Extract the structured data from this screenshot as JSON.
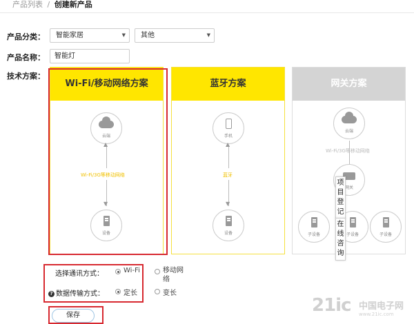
{
  "breadcrumb": {
    "parent": "产品列表",
    "separator": "/",
    "current": "创建新产品"
  },
  "form": {
    "category_label": "产品分类：",
    "category_primary": "智能家居",
    "category_secondary": "其他",
    "name_label": "产品名称：",
    "name_value": "智能灯",
    "solution_label": "技术方案："
  },
  "cards": {
    "wifi": {
      "title": "Wi-Fi/移动网络方案",
      "cloud_label": "云端",
      "link_text": "Wi-Fi/3G等移动网络",
      "device_label": "设备"
    },
    "bluetooth": {
      "title": "蓝牙方案",
      "phone_label": "手机",
      "link_text": "蓝牙",
      "device_label": "设备"
    },
    "gateway": {
      "title": "网关方案",
      "cloud_label": "云端",
      "link_text": "Wi-Fi/3G等移动网络",
      "gateway_label": "网关",
      "sub_device_label": "子设备"
    }
  },
  "options": {
    "comm_label": "选择通讯方式：",
    "comm_options": [
      "Wi-Fi",
      "移动网络"
    ],
    "comm_selected": "Wi-Fi",
    "transfer_label": "数据传输方式：",
    "transfer_options": [
      "定长",
      "变长"
    ],
    "transfer_selected": "定长"
  },
  "save_label": "保存",
  "float_tabs": {
    "register": "项目登记",
    "consult": "在线咨询"
  },
  "watermark": {
    "main": "21ic",
    "side": "中国电子网",
    "url": "www.21ic.com"
  },
  "colors": {
    "accent_yellow": "#ffe600",
    "highlight_red": "#d7282f",
    "gateway_gray": "#d4d4d4"
  }
}
